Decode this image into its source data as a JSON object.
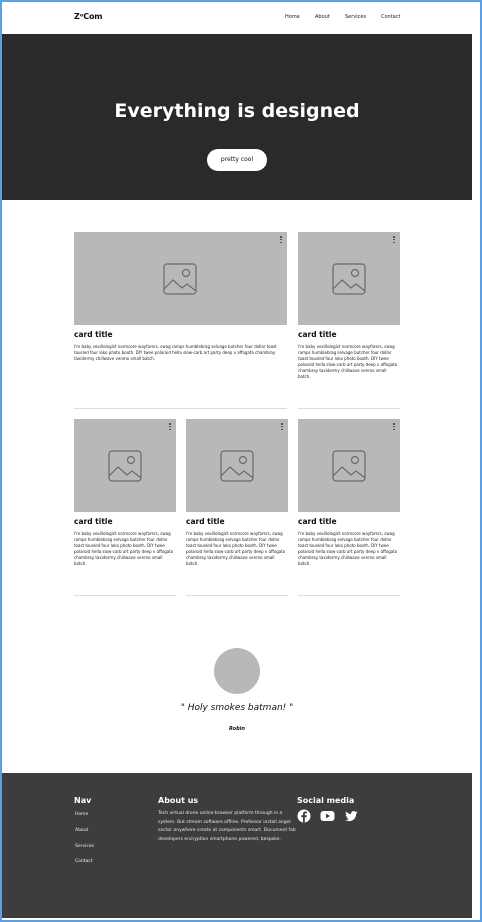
{
  "header": {
    "logo": "ZᵒCom",
    "nav": [
      "Home",
      "About",
      "Services",
      "Contact"
    ]
  },
  "hero": {
    "title": "Everything is designed",
    "button": "pretty cool"
  },
  "cards": [
    {
      "title": "card title",
      "text": "I'm baby vexillologist normcore wayfarers, swag ramps humblebrag selvage butcher four dollar toast tousled four loko photo booth. DIY twee polaroid hella slow-carb art party deep v affogato chambray taxidermy chillwave venmo small batch."
    },
    {
      "title": "card title",
      "text": "I'm baby vexillologist normcore wayfarers, swag ramps humblebrag selvage butcher four dollar toast tousled four loko photo booth. DIY twee polaroid hella slow-carb art party deep v affogato chambray taxidermy chillwave venmo small batch."
    },
    {
      "title": "card title",
      "text": "I'm baby vexillologist normcore wayfarers, swag ramps humblebrag selvage butcher four dollar toast tousled four loko photo booth. DIY twee polaroid hella slow-carb art party deep v affogato chambray taxidermy chillwave venmo small batch."
    },
    {
      "title": "card title",
      "text": "I'm baby vexillologist normcore wayfarers, swag ramps humblebrag selvage butcher four dollar toast tousled four loko photo booth. DIY twee polaroid hella slow-carb art party deep v affogato chambray taxidermy chillwave venmo small batch."
    },
    {
      "title": "card title",
      "text": "I'm baby vexillologist normcore wayfarers, swag ramps humblebrag selvage butcher four dollar toast tousled four loko photo booth. DIY twee polaroid hella slow-carb art party deep v affogato chambray taxidermy chillwave venmo small batch."
    }
  ],
  "testimonial": {
    "quote": "\" Holy smokes batman! \"",
    "author": "Robin"
  },
  "footer": {
    "nav_heading": "Nav",
    "nav_links": [
      "Home",
      "About",
      "Services",
      "Contact"
    ],
    "about_heading": "About us",
    "about_text": "Tech virtual drone online browser platform through in a system. But stream software offline. Professor install angel sector anywhere create at components smart. Document fab developers encryption smartphone powered, bespoke.",
    "social_heading": "Social media",
    "social_icons": [
      "facebook-icon",
      "youtube-icon",
      "twitter-icon"
    ]
  },
  "colors": {
    "hero_bg": "#2a2a2a",
    "footer_bg": "#3d3d3d",
    "placeholder": "#b8b8b8"
  }
}
